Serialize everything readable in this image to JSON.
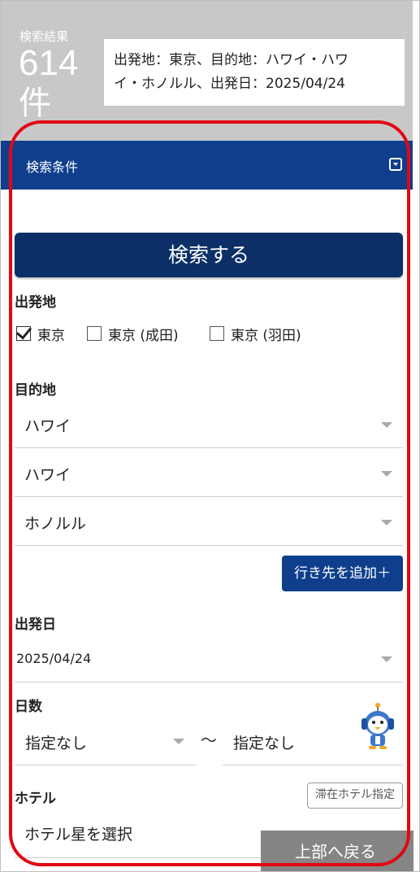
{
  "results": {
    "label": "検索結果",
    "count": "614",
    "unit": "件",
    "summary_line1": "出発地：東京、目的地：ハワイ・ハワ",
    "summary_line2": "イ・ホノルル、出発日：2025/04/24"
  },
  "conditions": {
    "title": "検索条件",
    "toggle_icon": "collapse-toggle-icon"
  },
  "search_button": "検索する",
  "departure": {
    "label": "出発地",
    "options": [
      {
        "label": "東京",
        "checked": true
      },
      {
        "label": "東京 (成田)",
        "checked": false
      },
      {
        "label": "東京 (羽田)",
        "checked": false
      }
    ]
  },
  "destination": {
    "label": "目的地",
    "selects": [
      "ハワイ",
      "ハワイ",
      "ホノルル"
    ],
    "add_button": "行き先を追加＋"
  },
  "departure_date": {
    "label": "出発日",
    "value": "2025/04/24"
  },
  "days": {
    "label": "日数",
    "from": "指定なし",
    "separator": "～",
    "to": "指定なし"
  },
  "hotel": {
    "label": "ホテル",
    "spec_button": "滞在ホテル指定",
    "star_select": "ホテル星を選択"
  },
  "back_to_top": "上部へ戻る",
  "colors": {
    "header_gray": "#c8c8c8",
    "brand_blue": "#0f3f8c",
    "search_blue": "#0b2f66",
    "highlight_red": "#e30613"
  }
}
